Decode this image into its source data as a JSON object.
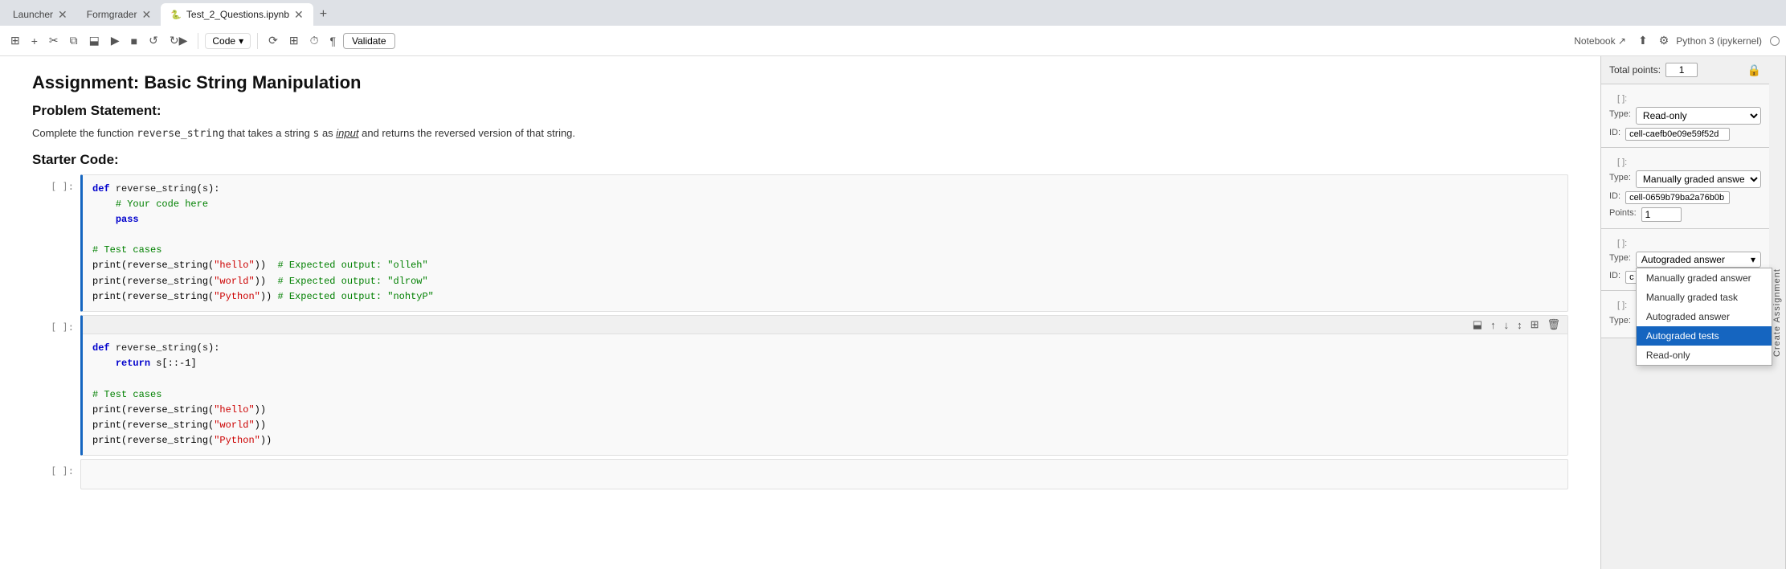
{
  "tabs": [
    {
      "label": "Launcher",
      "active": false,
      "icon": ""
    },
    {
      "label": "Formgrader",
      "active": false,
      "icon": ""
    },
    {
      "label": "Test_2_Questions.ipynb",
      "active": true,
      "icon": "🐍"
    }
  ],
  "toolbar": {
    "kernel_label": "Python 3 (ipykernel)",
    "validate_label": "Validate"
  },
  "notebook": {
    "title": "Assignment: Basic String Manipulation",
    "problem_heading": "Problem Statement:",
    "problem_text_parts": [
      "Complete the function ",
      "reverse_string",
      " that takes a string ",
      "s",
      " as ",
      "input",
      " and returns the reversed version of that string."
    ],
    "starter_heading": "Starter Code:"
  },
  "right_panel": {
    "total_points_label": "Total points:",
    "total_points_value": "1",
    "sections": [
      {
        "cell_ref": "[ ]:",
        "type_label": "Type:",
        "type_value": "Read-only",
        "id_label": "ID:",
        "id_value": "cell-caefb0e09e59f52d"
      },
      {
        "cell_ref": "[ ]:",
        "type_label": "Type:",
        "type_value": "Manually graded answer",
        "id_label": "ID:",
        "id_value": "cell-0659b79ba2a76b0b",
        "points_label": "Points:",
        "points_value": "1"
      },
      {
        "cell_ref": "[ ]:",
        "type_label": "Type:",
        "type_value": "Autograded answer",
        "id_label": "ID:",
        "id_value": "c",
        "dropdown_open": true,
        "dropdown_items": [
          {
            "label": "Manually graded answer",
            "selected": false
          },
          {
            "label": "Manually graded task",
            "selected": false
          },
          {
            "label": "Autograded answer",
            "selected": false
          },
          {
            "label": "Autograded tests",
            "selected": true
          },
          {
            "label": "Read-only",
            "selected": false
          }
        ]
      },
      {
        "cell_ref": "[ ]:",
        "type_label": "Type:",
        "type_value": "-"
      }
    ],
    "create_assignment_label": "Create Assignment"
  }
}
